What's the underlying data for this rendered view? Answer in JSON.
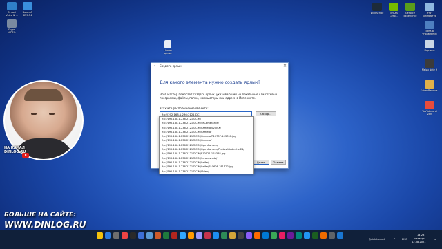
{
  "desktop": {
    "left_icons": [
      {
        "label": "Dynavi\nVIdeo & ...",
        "color": "#2f7fc9"
      },
      {
        "label": "DaemoN\nSE 5.5.2",
        "color": "#3a8fdc"
      },
      {
        "label": "Skype\nVIDEO",
        "color": "#7a8aa0"
      }
    ],
    "top_right_icons": [
      {
        "label": "Windscribe",
        "color": "#1d2b3a"
      },
      {
        "label": "NVIDIA\nGeFo...",
        "color": "#76b900"
      },
      {
        "label": "GeForce\nExperience",
        "color": "#5a9e1a"
      },
      {
        "label": "Этот\nкомпьютер",
        "color": "#8fb8e0"
      }
    ],
    "right_column_icons": [
      {
        "label": "Панель\nуправления",
        "color": "#4e7fc0"
      },
      {
        "label": "Корзина",
        "color": "#c9d6e6"
      },
      {
        "label": "Meizu Note 9",
        "color": "#3b3b3b"
      },
      {
        "label": "VideoRecords",
        "color": "#e0b04a"
      },
      {
        "label": "YouTube and\nZen",
        "color": "#e74c3c"
      }
    ],
    "new_shortcut_icon": {
      "label": "Новый\nярлык",
      "color": "#e9eef6"
    }
  },
  "dialog": {
    "window_title": "Создать ярлык",
    "heading": "Для какого элемента нужно создать ярлык?",
    "description": "Этот мастер помогает создать ярлык, указывающий на локальные или сетевые программы, файлы, папки, компьютеры или адреса в Интернете.",
    "field_label": "Укажите расположение объекта:",
    "field_value": "ftp://192.168.1.236:2121/DCI",
    "browse_label": "Обзор...",
    "next_label": "Далее",
    "cancel_label": "Отмена",
    "dropdown_items": [
      "ftp://192.168.1.236:2121/DCIM/",
      "ftp://192.168.1.236:2121/DCIM/4KCameraFile/",
      "ftp://192.168.1.236:2121/DCIM/Camera%20MX/",
      "ftp://192.168.1.236:2121/DCIM/Camera/",
      "ftp://192.168.1.236:2121/DCIM/Camera/P10707-103700.jpg",
      "ftp://192.168.1.236:2121/DCIM/Camera/",
      "ftp://192.168.1.236:2121/DCIM/OpenCamera/",
      "ftp://192.168.1.236:2121/DCIM/OpenCamera/Photos.Xladinshe.21/",
      "ftp://192.168.1.236:2121/DCIM/P10721-125348.jpg",
      "ftp://192.168.1.236:2121/DCIM/Screenshots/",
      "ftp://192.168.1.236:2121/DCIM/Selfie/",
      "ftp://192.168.1.236:2121/DCIM/Selfie/P10608-181722.jpg",
      "ftp://192.168.1.236:2121/DCIM/Video/"
    ]
  },
  "overlay": {
    "channel_line1": "НА КАНАЛ",
    "channel_line2": "DINLOG.RU",
    "promo_line1": "БОЛЬШЕ НА САЙТЕ:",
    "promo_line2": "WWW.DINLOG.RU"
  },
  "taskbar": {
    "quick_launch": "Quick Launch",
    "language": "ENG",
    "time": "14:23",
    "day": "четверг",
    "date": "12.08.2021",
    "icon_colors": [
      "#f4c20d",
      "#2a7ae2",
      "#6e6e6e",
      "#e44",
      "#2a2a2a",
      "#3d6fd6",
      "#5b9bd5",
      "#cc5a2a",
      "#1f7a3d",
      "#b3261e",
      "#31a8ff",
      "#ff9a00",
      "#9999ff",
      "#c7334d",
      "#1d8df0",
      "#2e8b57",
      "#d2a63a",
      "#444",
      "#8b5cf6",
      "#ff6a00",
      "#0078d4",
      "#3aa757",
      "#e91e63",
      "#6a1b9a",
      "#00897b",
      "#2196f3",
      "#1b5e20",
      "#ef6c00",
      "#5f6368",
      "#1976d2"
    ]
  }
}
